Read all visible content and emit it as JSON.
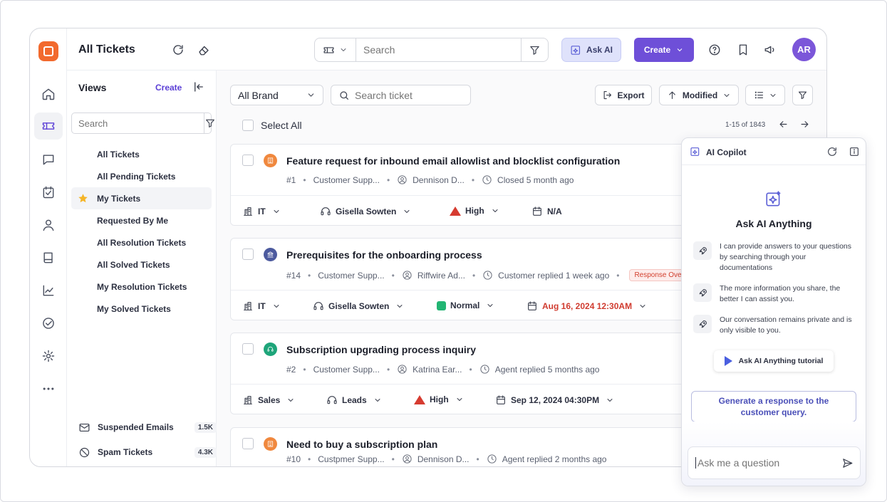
{
  "topbar": {
    "title": "All Tickets",
    "search_placeholder": "Search",
    "ask_ai_label": "Ask AI",
    "create_label": "Create",
    "avatar_initials": "AR"
  },
  "views": {
    "title": "Views",
    "create_label": "Create",
    "search_placeholder": "Search",
    "items": [
      {
        "label": "All Tickets"
      },
      {
        "label": "All Pending Tickets"
      },
      {
        "label": "My Tickets"
      },
      {
        "label": "Requested By Me"
      },
      {
        "label": "All Resolution Tickets"
      },
      {
        "label": "All Solved Tickets"
      },
      {
        "label": "My Resolution Tickets"
      },
      {
        "label": "My Solved Tickets"
      }
    ],
    "bottom": [
      {
        "label": "Suspended Emails",
        "count": "1.5K"
      },
      {
        "label": "Spam Tickets",
        "count": "4.3K"
      }
    ]
  },
  "toolbar": {
    "brand": "All Brand",
    "search_placeholder": "Search ticket",
    "export_label": "Export",
    "modified_label": "Modified",
    "select_all": "Select All",
    "pagination": "1-15 of 1843"
  },
  "tickets": [
    {
      "title": "Feature request for inbound email allowlist and blocklist configuration",
      "id": "#1",
      "team": "Customer Supp...",
      "assignee": "Dennison D...",
      "status": "Closed 5 month ago",
      "badge": "",
      "group": "IT",
      "agent": "Gisella Sowten",
      "priority": "High",
      "due": "N/A",
      "icon_color": "#f0883e"
    },
    {
      "title": "Prerequisites for the onboarding process",
      "id": "#14",
      "team": "Customer Supp...",
      "assignee": "Riffwire Ad...",
      "status": "Customer replied 1 week ago",
      "badge": "Response Ove",
      "group": "IT",
      "agent": "Gisella Sowten",
      "priority": "Normal",
      "due": "Aug 16, 2024 12:30AM",
      "icon_color": "#4c5a9e"
    },
    {
      "title": "Subscription upgrading process inquiry",
      "id": "#2",
      "team": "Customer Supp...",
      "assignee": "Katrina Ear...",
      "status": "Agent replied 5 months ago",
      "badge": "",
      "group": "Sales",
      "agent": "Leads",
      "priority": "High",
      "due": "Sep 12, 2024 04:30PM",
      "icon_color": "#1ea57a"
    },
    {
      "title": "Need to buy a subscription plan",
      "id": "#10",
      "team": "Custpmer Supp...",
      "assignee": "Dennison D...",
      "status": "Agent replied 2 months ago",
      "badge": "",
      "icon_color": "#f0883e"
    }
  ],
  "copilot": {
    "title": "AI Copilot",
    "heading": "Ask AI Anything",
    "tips": [
      "I can provide answers to your questions by searching through your documentations",
      "The more information you share, the better I can assist you.",
      "Our conversation remains private and is only visible to you."
    ],
    "tutorial_label": "Ask AI Anything tutorial",
    "suggestion": "Generate a response to the customer query.",
    "input_placeholder": "Ask me a question"
  },
  "colors": {
    "accent": "#6e4fd8",
    "priority_high": "#d63b30",
    "priority_normal": "#22b573",
    "overdue": "#d03c30"
  }
}
